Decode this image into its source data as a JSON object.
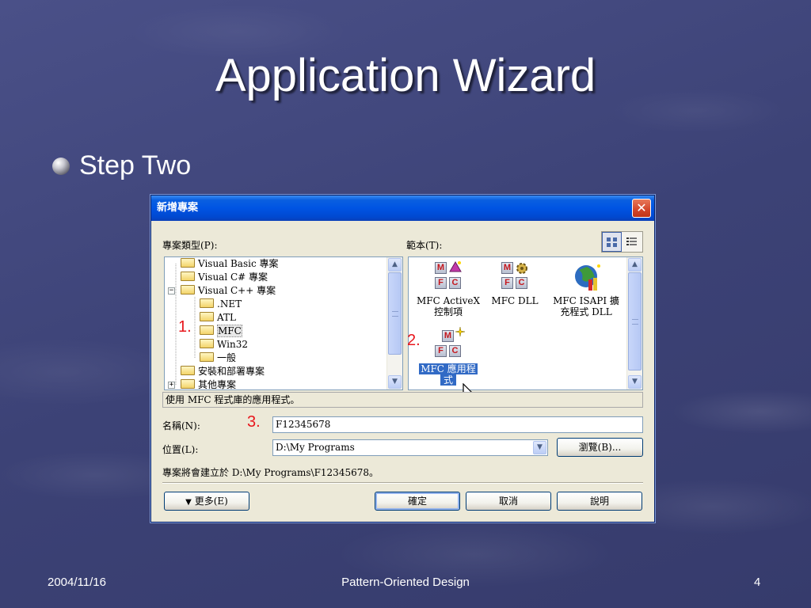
{
  "slide": {
    "title": "Application Wizard",
    "bullet": "Step Two",
    "footer_date": "2004/11/16",
    "footer_center": "Pattern-Oriented Design",
    "page_number": "4"
  },
  "dialog": {
    "title": "新增專案",
    "close_label": "✕",
    "project_types_label": "專案類型(P):",
    "templates_label": "範本(T):",
    "tree": [
      {
        "label": "Visual Basic 專案",
        "level": 0,
        "expander": ""
      },
      {
        "label": "Visual C# 專案",
        "level": 0,
        "expander": ""
      },
      {
        "label": "Visual C++ 專案",
        "level": 0,
        "expander": "−"
      },
      {
        "label": ".NET",
        "level": 1,
        "expander": ""
      },
      {
        "label": "ATL",
        "level": 1,
        "expander": ""
      },
      {
        "label": "MFC",
        "level": 1,
        "expander": ""
      },
      {
        "label": "Win32",
        "level": 1,
        "expander": ""
      },
      {
        "label": "一般",
        "level": 1,
        "expander": ""
      },
      {
        "label": "安裝和部署專案",
        "level": 0,
        "expander": ""
      },
      {
        "label": "其他專案",
        "level": 0,
        "expander": "+"
      }
    ],
    "templates": [
      {
        "label_1": "MFC ActiveX",
        "label_2": "控制項"
      },
      {
        "label_1": "MFC DLL",
        "label_2": ""
      },
      {
        "label_1": "MFC ISAPI 擴",
        "label_2": "充程式 DLL"
      },
      {
        "label_1": "MFC 應用程",
        "label_2": "式"
      }
    ],
    "description": "使用 MFC 程式庫的應用程式。",
    "name_label": "名稱(N):",
    "name_value": "F12345678",
    "location_label": "位置(L):",
    "location_value": "D:\\My Programs",
    "browse_button": "瀏覽(B)...",
    "create_path_text": "專案將會建立於 D:\\My Programs\\F12345678。",
    "more_button": "更多(E)",
    "ok_button": "確定",
    "cancel_button": "取消",
    "help_button": "說明"
  },
  "markers": {
    "step1": "1.",
    "step2": "2.",
    "step3": "3."
  },
  "colors": {
    "marker_red": "#e8161c",
    "title_bar_blue": "#0054e3",
    "selection_blue": "#316ac5"
  }
}
